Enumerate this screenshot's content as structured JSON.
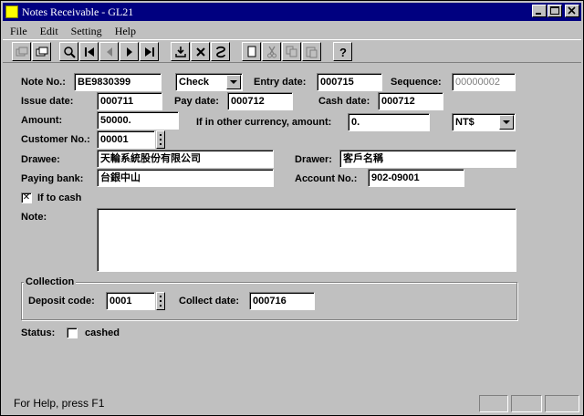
{
  "window": {
    "title": "Notes Receivable - GL21"
  },
  "menu": {
    "file": "File",
    "edit": "Edit",
    "setting": "Setting",
    "help": "Help"
  },
  "form": {
    "note_no_label": "Note No.:",
    "note_no": "BE9830399",
    "note_type": "Check",
    "entry_date_label": "Entry date:",
    "entry_date": "000715",
    "sequence_label": "Sequence:",
    "sequence": "00000002",
    "issue_date_label": "Issue date:",
    "issue_date": "000711",
    "pay_date_label": "Pay date:",
    "pay_date": "000712",
    "cash_date_label": "Cash date:",
    "cash_date": "000712",
    "amount_label": "Amount:",
    "amount": "50000.",
    "other_currency_label": "If in other currency, amount:",
    "other_amount": "0.",
    "currency": "NT$",
    "customer_no_label": "Customer No.:",
    "customer_no": "00001",
    "drawee_label": "Drawee:",
    "drawee": "天輪系統股份有限公司",
    "drawer_label": "Drawer:",
    "drawer": "客戶名稱",
    "paying_bank_label": "Paying bank:",
    "paying_bank": "台銀中山",
    "account_no_label": "Account No.:",
    "account_no": "902-09001",
    "if_to_cash_label": "If to cash",
    "if_to_cash_mark": "✕",
    "note_label": "Note:",
    "collection_title": "Collection",
    "deposit_code_label": "Deposit code:",
    "deposit_code": "0001",
    "collect_date_label": "Collect date:",
    "collect_date": "000716",
    "status_label": "Status:",
    "cashed_label": "cashed"
  },
  "statusbar": {
    "text": "For Help, press F1"
  },
  "icons": [
    "cut-icon",
    "copy-doc-icon",
    "search-icon",
    "first-record-icon",
    "previous-record-icon",
    "next-record-icon",
    "last-record-icon",
    "save-icon",
    "delete-icon",
    "refresh-icon",
    "new-icon",
    "scissors-icon",
    "copy-icon",
    "paste-icon",
    "help-icon"
  ]
}
